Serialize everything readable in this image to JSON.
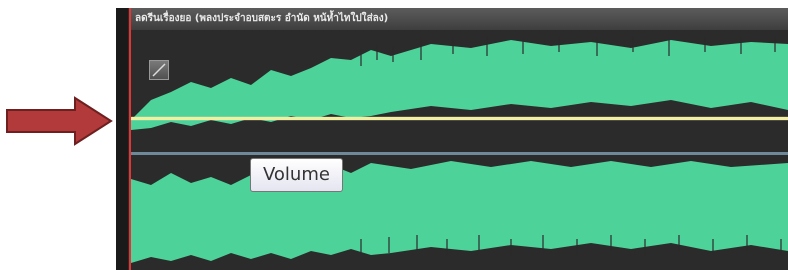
{
  "clip": {
    "title": "ลดรีนเรื่องยอ (พลงประจำอบสตะร อำนัด หน้ห้ำไทใปใส่ลง)"
  },
  "tooltip": {
    "label": "Volume"
  },
  "colors": {
    "waveform": "#4dd39a",
    "background": "#2b2b2b",
    "volume_line": "#f2f0a0",
    "playhead": "#e23636",
    "arrow": "#b23a3a"
  }
}
